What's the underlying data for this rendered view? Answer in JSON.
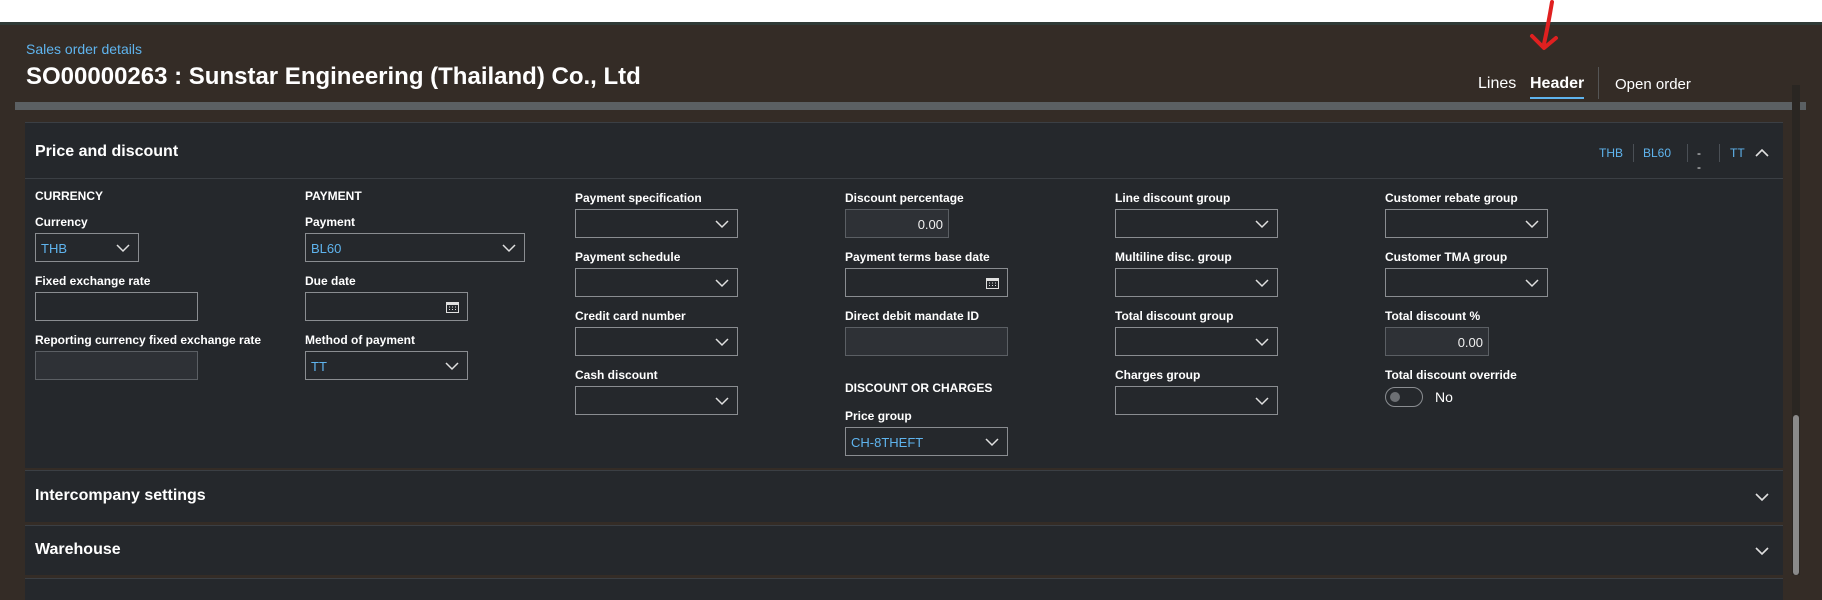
{
  "breadcrumb": "Sales order details",
  "title": "SO00000263 : Sunstar Engineering (Thailand) Co., Ltd",
  "tabs": {
    "lines": "Lines",
    "header": "Header",
    "open_order": "Open order"
  },
  "colors": {
    "background": "#342c26",
    "panel": "#25282c",
    "accent": "#5fb4ee",
    "annotation": "#e02020"
  },
  "panels": {
    "price_discount": {
      "title": "Price and discount",
      "expanded": true,
      "summary": [
        "THB",
        "BL60",
        "--",
        "TT"
      ],
      "currency": {
        "section": "CURRENCY",
        "currency_label": "Currency",
        "currency_value": "THB",
        "fixed_rate_label": "Fixed exchange rate",
        "fixed_rate_value": "",
        "reporting_rate_label": "Reporting currency fixed exchange rate",
        "reporting_rate_value": ""
      },
      "payment": {
        "section": "PAYMENT",
        "payment_label": "Payment",
        "payment_value": "BL60",
        "due_date_label": "Due date",
        "due_date_value": "",
        "method_label": "Method of payment",
        "method_value": "TT"
      },
      "col3": {
        "spec_label": "Payment specification",
        "schedule_label": "Payment schedule",
        "card_label": "Credit card number",
        "cash_label": "Cash discount"
      },
      "col4": {
        "discount_pct_label": "Discount percentage",
        "discount_pct_value": "0.00",
        "base_date_label": "Payment terms base date",
        "mandate_label": "Direct debit mandate ID",
        "charges_section": "DISCOUNT OR CHARGES",
        "price_group_label": "Price group",
        "price_group_value": "CH-8THEFT"
      },
      "col5": {
        "line_disc_label": "Line discount group",
        "multiline_label": "Multiline disc. group",
        "total_disc_group_label": "Total discount group",
        "charges_group_label": "Charges group"
      },
      "col6": {
        "rebate_label": "Customer rebate group",
        "tma_label": "Customer TMA group",
        "total_disc_pct_label": "Total discount %",
        "total_disc_pct_value": "0.00",
        "override_label": "Total discount override",
        "override_value": "No"
      }
    },
    "intercompany": {
      "title": "Intercompany settings"
    },
    "warehouse": {
      "title": "Warehouse"
    }
  }
}
